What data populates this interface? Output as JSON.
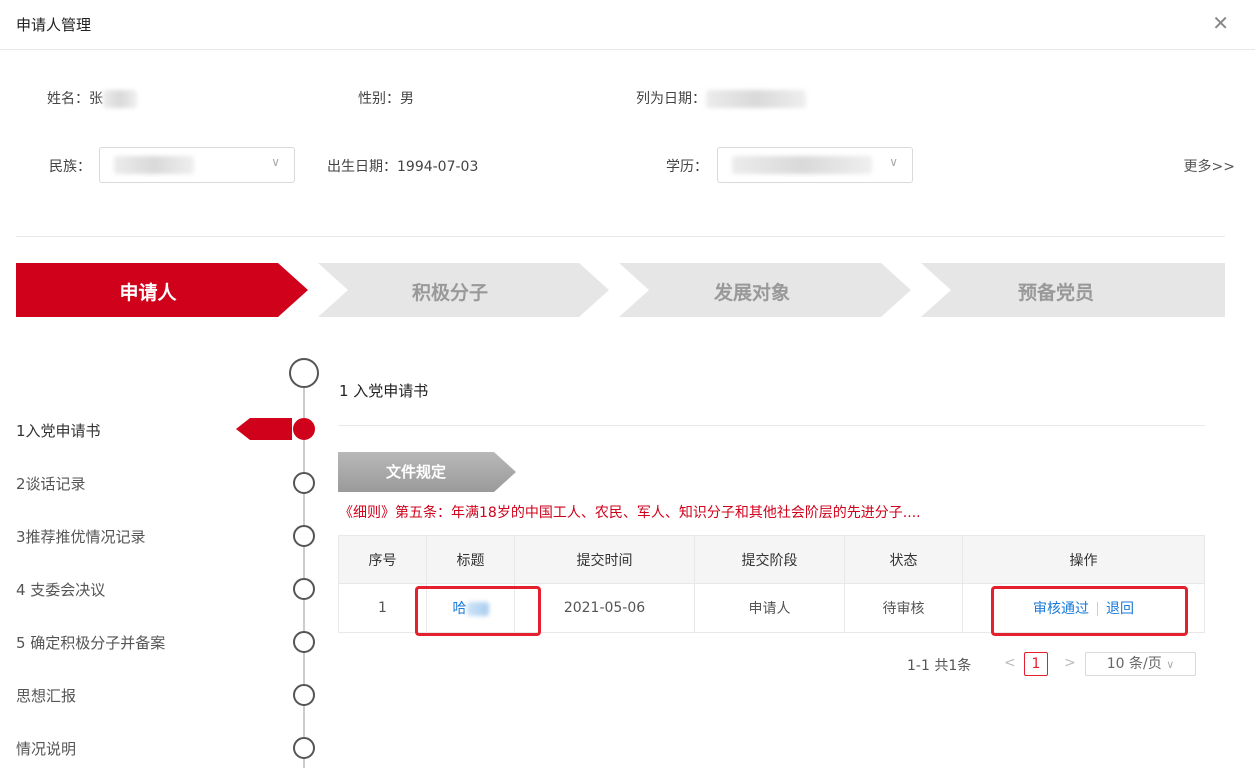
{
  "modal": {
    "title": "申请人管理",
    "close_glyph": "✕"
  },
  "info": {
    "name_label": "姓名：张",
    "gender_label": "性别：",
    "gender_value": "男",
    "listed_date_label": "列为日期：",
    "ethnicity_label": "民族：",
    "birth_label": "出生日期：",
    "birth_value": "1994-07-03",
    "education_label": "学历：",
    "more_link": "更多>>"
  },
  "steps": [
    "申请人",
    "积极分子",
    "发展对象",
    "预备党员"
  ],
  "timeline": [
    "1入党申请书",
    "2谈话记录",
    "3推荐推优情况记录",
    "4 支委会决议",
    "5 确定积极分子并备案",
    "思想汇报",
    "情况说明"
  ],
  "section": {
    "title": "1 入党申请书",
    "doc_tag": "文件规定",
    "rule_text": "《细则》第五条：年满18岁的中国工人、农民、军人、知识分子和其他社会阶层的先进分子...."
  },
  "table": {
    "headers": [
      "序号",
      "标题",
      "提交时间",
      "提交阶段",
      "状态",
      "操作"
    ],
    "rows": [
      {
        "index": "1",
        "title": "哈",
        "submit_time": "2021-05-06",
        "stage": "申请人",
        "status": "待审核",
        "approve": "审核通过",
        "reject": "退回"
      }
    ]
  },
  "pagination": {
    "summary": "1-1 共1条",
    "prev": "<",
    "current": "1",
    "next": ">",
    "page_size": "10 条/页"
  },
  "colors": {
    "accent": "#d0021b",
    "link": "#1a7ad9",
    "highlight": "#e5202e"
  }
}
